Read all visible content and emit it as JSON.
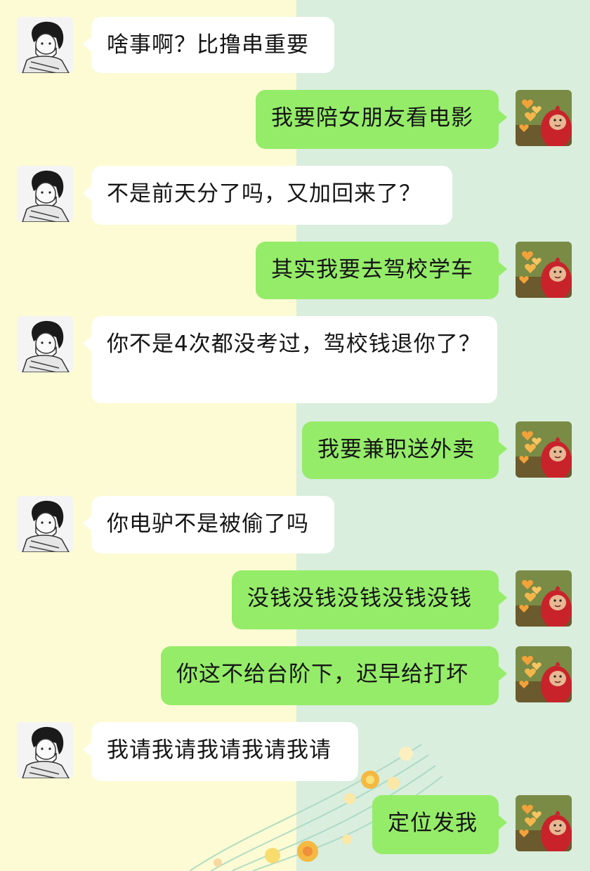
{
  "chat": {
    "messages": [
      {
        "side": "left",
        "text": "啥事啊？比撸串重要"
      },
      {
        "side": "right",
        "text": "我要陪女朋友看电影"
      },
      {
        "side": "left",
        "text": "不是前天分了吗，又加回来了？"
      },
      {
        "side": "right",
        "text": "其实我要去驾校学车"
      },
      {
        "side": "left",
        "text": "你不是4次都没考过，驾校钱退你了？"
      },
      {
        "side": "right",
        "text": "我要兼职送外卖"
      },
      {
        "side": "left",
        "text": "你电驴不是被偷了吗"
      },
      {
        "side": "right",
        "text": "没钱没钱没钱没钱没钱"
      },
      {
        "side": "right",
        "text": "你这不给台阶下，迟早给打坏"
      },
      {
        "side": "left",
        "text": "我请我请我请我请我请"
      },
      {
        "side": "right",
        "text": "定位发我"
      }
    ]
  },
  "colors": {
    "left_background": "#fdfbd3",
    "right_background": "#d9eedd",
    "incoming_bubble": "#ffffff",
    "outgoing_bubble": "#95ec69"
  },
  "icons": {
    "incoming_avatar": "sketched-boy-with-mask-avatar",
    "outgoing_avatar": "red-teletubby-with-hearts-avatar"
  }
}
